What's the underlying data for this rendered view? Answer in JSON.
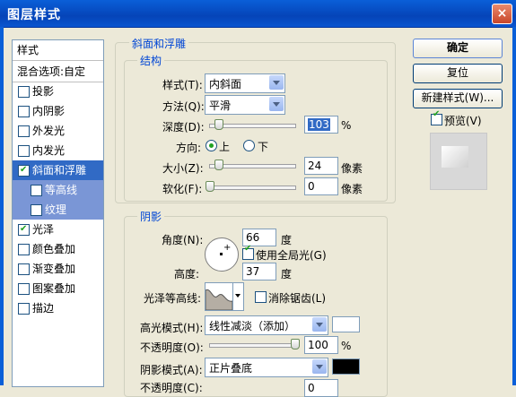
{
  "window": {
    "title": "图层样式",
    "close": "×"
  },
  "left_list": {
    "header": "样式",
    "blend": "混合选项:自定",
    "items": [
      {
        "label": "投影",
        "checked": false
      },
      {
        "label": "内阴影",
        "checked": false
      },
      {
        "label": "外发光",
        "checked": false
      },
      {
        "label": "内发光",
        "checked": false
      },
      {
        "label": "斜面和浮雕",
        "checked": true
      },
      {
        "label": "等高线",
        "checked": false
      },
      {
        "label": "纹理",
        "checked": false
      },
      {
        "label": "光泽",
        "checked": true
      },
      {
        "label": "颜色叠加",
        "checked": false
      },
      {
        "label": "渐变叠加",
        "checked": false
      },
      {
        "label": "图案叠加",
        "checked": false
      },
      {
        "label": "描边",
        "checked": false
      }
    ]
  },
  "bevel": {
    "group_title": "斜面和浮雕",
    "structure_title": "结构",
    "style_label": "样式(T):",
    "style_value": "内斜面",
    "method_label": "方法(Q):",
    "method_value": "平滑",
    "depth_label": "深度(D):",
    "depth_value": "103",
    "depth_unit": "%",
    "depth_level": 0.1,
    "direction_label": "方向:",
    "dir_up": "上",
    "dir_down": "下",
    "size_label": "大小(Z):",
    "size_value": "24",
    "size_unit": "像素",
    "size_level": 0.1,
    "soften_label": "软化(F):",
    "soften_value": "0",
    "soften_unit": "像素",
    "soften_level": 0
  },
  "shading": {
    "title": "阴影",
    "angle_label": "角度(N):",
    "angle_value": "66",
    "angle_unit": "度",
    "global_light_label": "使用全局光(G)",
    "global_light_checked": true,
    "altitude_label": "高度:",
    "altitude_value": "37",
    "altitude_unit": "度",
    "gloss_label": "光泽等高线:",
    "antialias_label": "消除锯齿(L)",
    "antialias_checked": false,
    "highlight_mode_label": "高光模式(H):",
    "highlight_mode_value": "线性减淡（添加）",
    "highlight_color": "#ffffff",
    "opacity1_label": "不透明度(O):",
    "opacity1_value": "100",
    "opacity1_unit": "%",
    "opacity1_level": 1.0,
    "shadow_mode_label": "阴影模式(A):",
    "shadow_mode_value": "正片叠底",
    "shadow_color": "#000000",
    "opacity2_label": "不透明度(C):",
    "opacity2_value": "0"
  },
  "buttons": {
    "ok": "确定",
    "reset": "复位",
    "new_style": "新建样式(W)...",
    "preview": "预览(V)",
    "preview_checked": true
  }
}
